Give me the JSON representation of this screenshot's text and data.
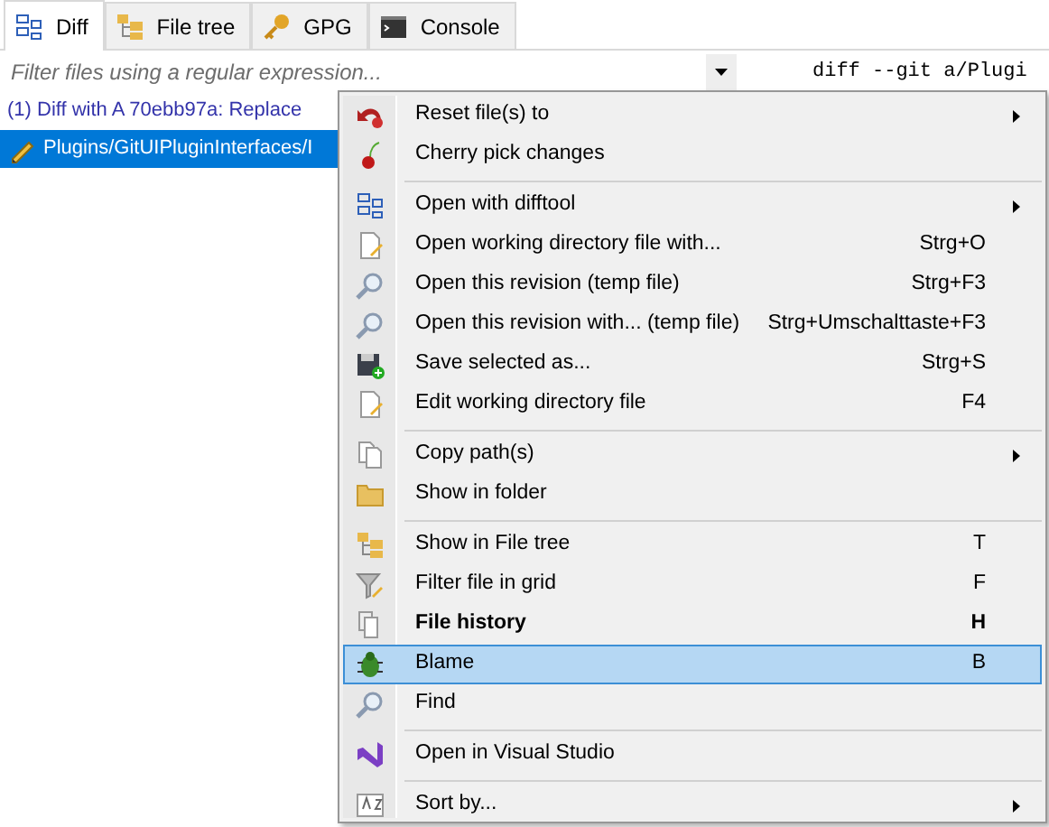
{
  "tabs": [
    {
      "label": "Diff",
      "selected": true
    },
    {
      "label": "File tree",
      "selected": false
    },
    {
      "label": "GPG",
      "selected": false
    },
    {
      "label": "Console",
      "selected": false
    }
  ],
  "filter": {
    "placeholder": "Filter files using a regular expression..."
  },
  "files": [
    {
      "kind": "group",
      "label": "(1) Diff with A 70ebb97a: Replace",
      "selected": false
    },
    {
      "kind": "file",
      "label": "Plugins/GitUIPluginInterfaces/I",
      "selected": true
    }
  ],
  "diff_text": "diff --git a/Plugi",
  "menu": [
    {
      "kind": "item",
      "label": "Reset file(s) to",
      "submenu": true,
      "selected": false
    },
    {
      "kind": "item",
      "label": "Cherry pick changes",
      "selected": false
    },
    {
      "kind": "separator"
    },
    {
      "kind": "item",
      "label": "Open with difftool",
      "submenu": true,
      "selected": false
    },
    {
      "kind": "item",
      "label": "Open working directory file with...",
      "shortcut": "Strg+O",
      "selected": false
    },
    {
      "kind": "item",
      "label": "Open this revision (temp file)",
      "shortcut": "Strg+F3",
      "selected": false
    },
    {
      "kind": "item",
      "label": "Open this revision with... (temp file)",
      "shortcut": "Strg+Umschalttaste+F3",
      "selected": false
    },
    {
      "kind": "item",
      "label": "Save selected as...",
      "shortcut": "Strg+S",
      "selected": false
    },
    {
      "kind": "item",
      "label": "Edit working directory file",
      "shortcut": "F4",
      "selected": false
    },
    {
      "kind": "separator"
    },
    {
      "kind": "item",
      "label": "Copy path(s)",
      "submenu": true,
      "selected": false
    },
    {
      "kind": "item",
      "label": "Show in folder",
      "selected": false
    },
    {
      "kind": "separator"
    },
    {
      "kind": "item",
      "label": "Show in File tree",
      "shortcut": "T",
      "selected": false
    },
    {
      "kind": "item",
      "label": "Filter file in grid",
      "shortcut": "F",
      "selected": false
    },
    {
      "kind": "item",
      "label": "File history",
      "shortcut": "H",
      "bold": true,
      "selected": false
    },
    {
      "kind": "item",
      "label": "Blame",
      "shortcut": "B",
      "selected": true
    },
    {
      "kind": "item",
      "label": "Find",
      "selected": false
    },
    {
      "kind": "separator"
    },
    {
      "kind": "item",
      "label": "Open in Visual Studio",
      "selected": false
    },
    {
      "kind": "separator"
    },
    {
      "kind": "item",
      "label": "Sort by...",
      "submenu": true,
      "selected": false
    }
  ]
}
